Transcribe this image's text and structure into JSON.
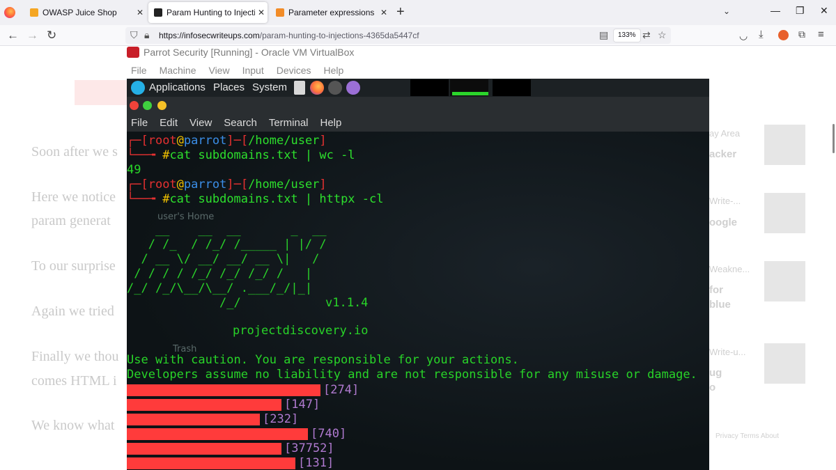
{
  "browser": {
    "tabs": [
      {
        "title": "OWASP Juice Shop",
        "active": false
      },
      {
        "title": "Param Hunting to Injections. He",
        "active": true
      },
      {
        "title": "Parameter expressions",
        "active": false
      }
    ],
    "url_host": "https://infosecwriteups.com",
    "url_path": "/param-hunting-to-injections-4365da5447cf",
    "zoom": "133%"
  },
  "article": {
    "paragraphs": [
      "Soon after we s",
      "Here we notice",
      "param generat",
      "To our surprise",
      "Again we tried",
      "Finally we thou",
      "comes HTML i",
      "We know what"
    ],
    "sidebar": {
      "items": [
        "ay Area",
        "acker",
        "Write-...",
        "oogle",
        "Weakne...",
        "for",
        "blue",
        "Write-u...",
        "ug",
        "o"
      ],
      "footer_links": [
        "Privacy",
        "Terms",
        "About"
      ]
    }
  },
  "virtualbox": {
    "title": "Parrot Security [Running] - Oracle VM VirtualBox",
    "menu": [
      "File",
      "Machine",
      "View",
      "Input",
      "Devices",
      "Help"
    ]
  },
  "guest": {
    "panel": {
      "items": [
        "Applications",
        "Places",
        "System"
      ]
    },
    "desktop_icons": [
      "user's Home",
      "Trash"
    ],
    "terminal": {
      "menu": [
        "File",
        "Edit",
        "View",
        "Search",
        "Terminal",
        "Help"
      ],
      "prompt_user": "root",
      "prompt_host": "parrot",
      "prompt_path": "/home/user",
      "cmd1": "cat subdomains.txt | wc -l",
      "output1": "49",
      "cmd2": "cat subdomains.txt | httpx -cl",
      "banner": [
        "    __    __  __       _  __",
        "   / /_  / /_/ /_____ | |/ /",
        "  / __ \\/ __/ __/ __ \\|   /",
        " / / / / /_/ /_/ /_/ /   |",
        "/_/ /_/\\__/\\__/ .___/_/|_|",
        "             /_/"
      ],
      "version": "v1.1.4",
      "site": "projectdiscovery.io",
      "warning1": "Use with caution. You are responsible for your actions.",
      "warning2": "Developers assume no liability and are not responsible for any misuse or damage.",
      "results": [
        {
          "count": "[274]",
          "bar_fraction": 0.333
        },
        {
          "count": "[147]",
          "bar_fraction": 0.265
        },
        {
          "count": "[232]",
          "bar_fraction": 0.229
        },
        {
          "count": "[740]",
          "bar_fraction": 0.311
        },
        {
          "count": "[37752]",
          "bar_fraction": 0.265
        },
        {
          "count": "[131]",
          "bar_fraction": 0.289
        }
      ]
    }
  },
  "colors": {
    "prompt_red": "#e63131",
    "terminal_green": "#28d428",
    "redaction": "#ff3b3b",
    "count_purple": "#b07ad0"
  }
}
